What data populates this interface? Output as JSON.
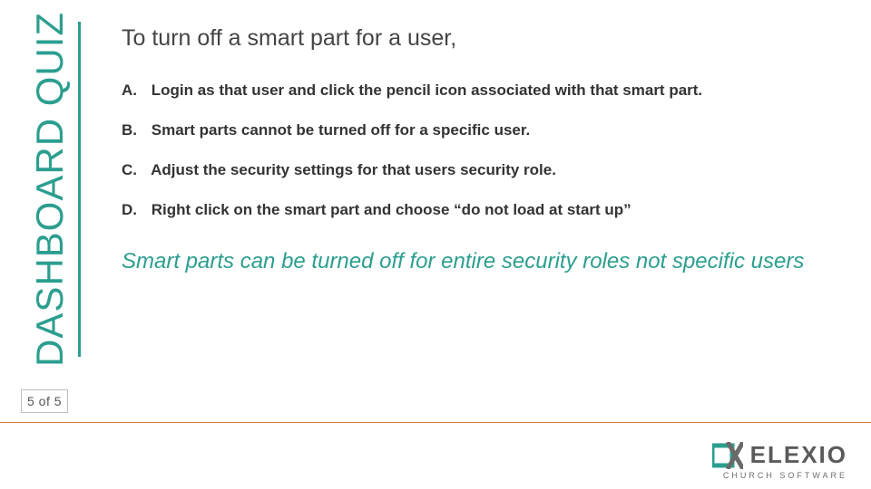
{
  "side_label": "DASHBOARD QUIZ",
  "question": "To turn off a smart part for a user,",
  "options": [
    {
      "letter": "A.",
      "text": "Login as that user and click the pencil icon associated with that smart part."
    },
    {
      "letter": "B.",
      "text": "Smart parts cannot be turned off for a specific user."
    },
    {
      "letter": "C.",
      "text": "Adjust the security settings for that users security role."
    },
    {
      "letter": "D.",
      "text": "Right click on the smart part and choose “do not load at start up”"
    }
  ],
  "answer_note": "Smart parts can be turned off for entire security roles not specific users",
  "pager": "5 of 5",
  "logo": {
    "word": "ELEXIO",
    "sub": "CHURCH SOFTWARE"
  },
  "colors": {
    "accent": "#2b9e8f",
    "rule": "#d07d3c"
  }
}
